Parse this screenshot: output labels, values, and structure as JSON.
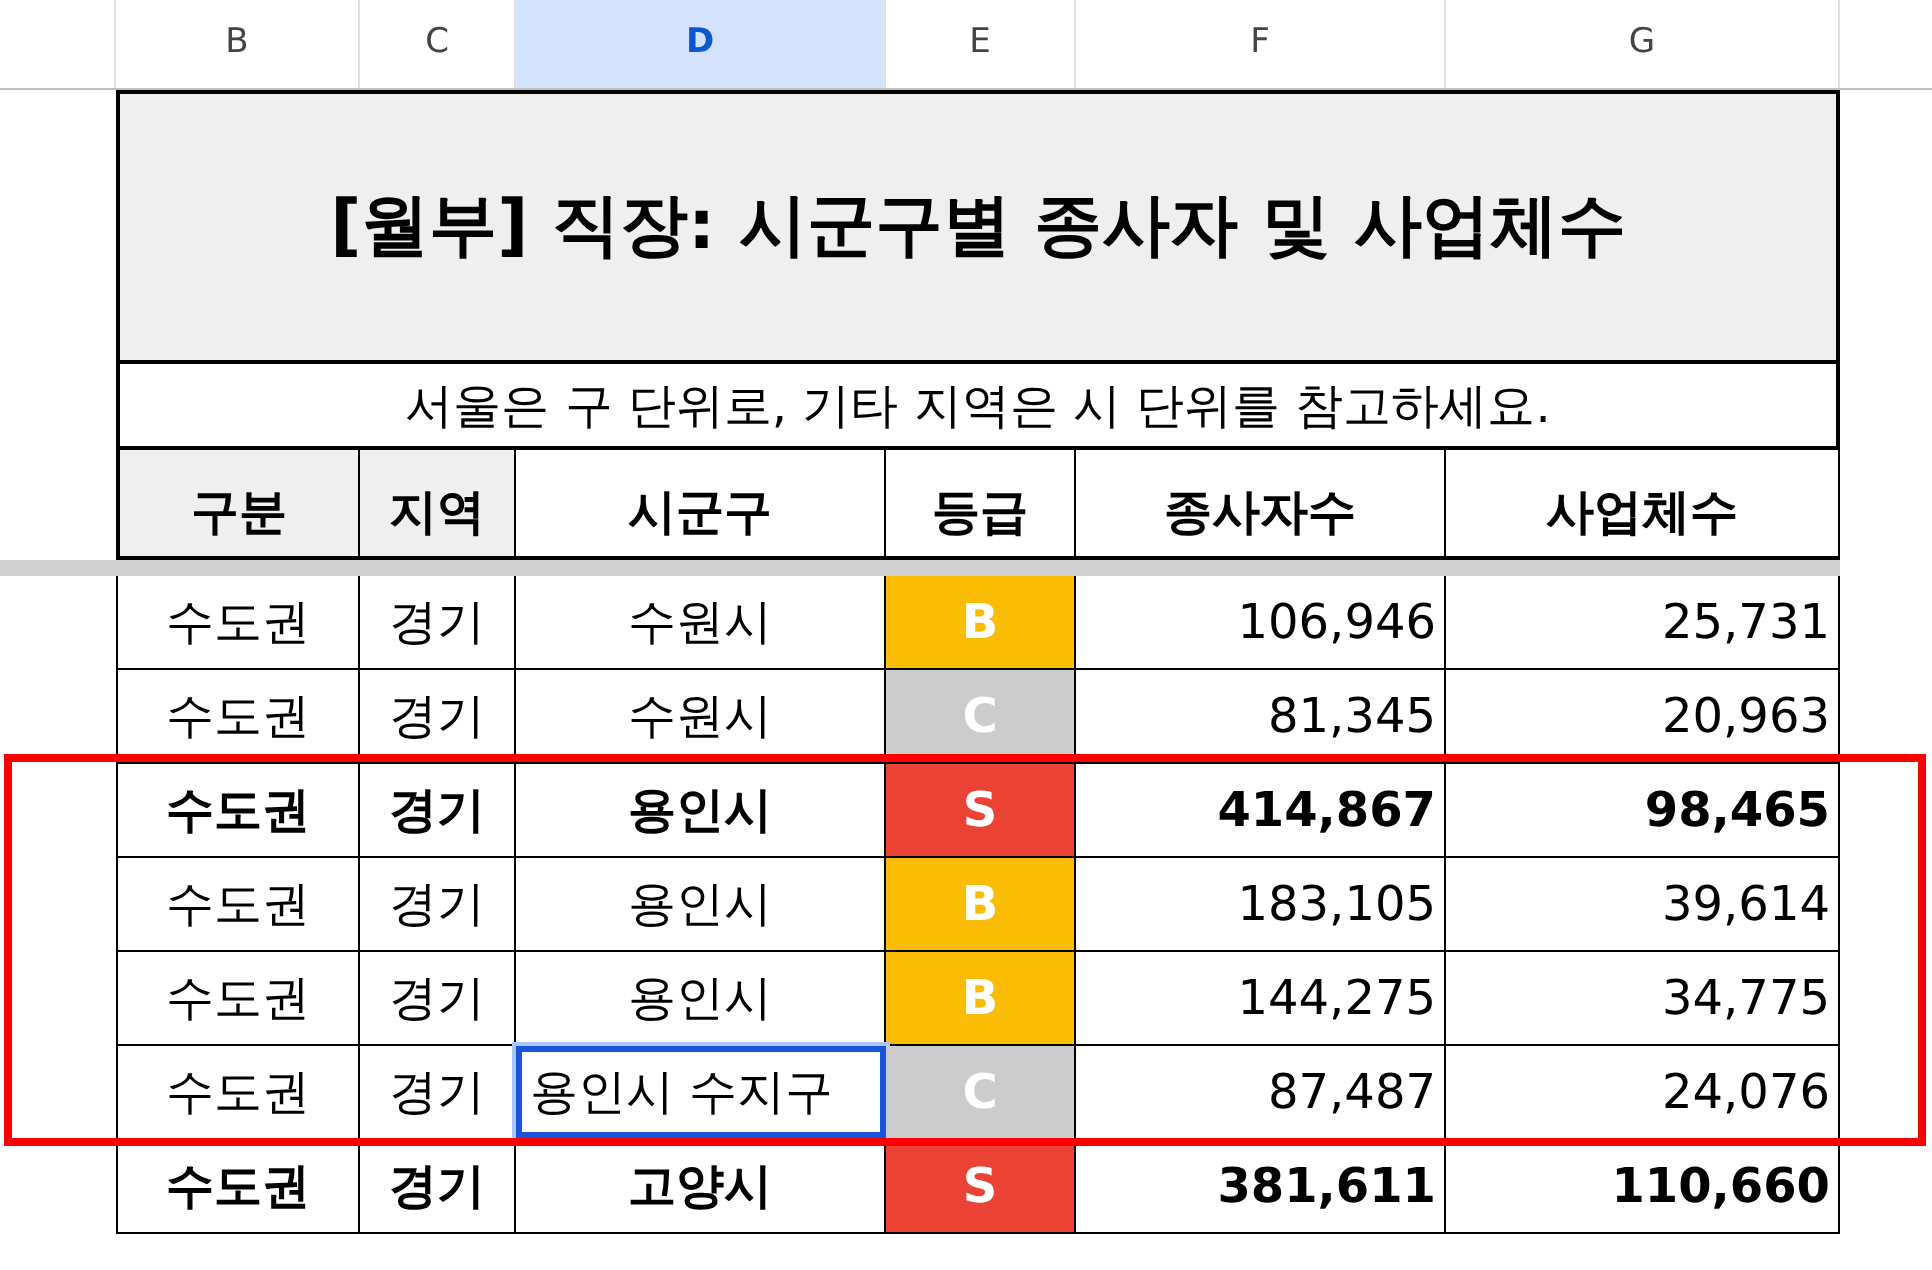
{
  "column_letters": [
    {
      "label": "B",
      "selected": false
    },
    {
      "label": "C",
      "selected": false
    },
    {
      "label": "D",
      "selected": true
    },
    {
      "label": "E",
      "selected": false
    },
    {
      "label": "F",
      "selected": false
    },
    {
      "label": "G",
      "selected": false
    }
  ],
  "title": "[월부] 직장: 시군구별 종사자 및 사업체수",
  "subtitle": "서울은 구 단위로, 기타 지역은 시 단위를 참고하세요.",
  "headers": [
    "구분",
    "지역",
    "시군구",
    "등급",
    "종사자수",
    "사업체수"
  ],
  "rows": [
    {
      "group": "수도권",
      "region": "경기",
      "district": "수원시",
      "grade": "B",
      "color": "#fbbc04",
      "workers": "106,946",
      "businesses": "25,731",
      "bold": false,
      "selected": false,
      "highlighted": false
    },
    {
      "group": "수도권",
      "region": "경기",
      "district": "수원시",
      "grade": "C",
      "color": "#cccccc",
      "workers": "81,345",
      "businesses": "20,963",
      "bold": false,
      "selected": false,
      "highlighted": false
    },
    {
      "group": "수도권",
      "region": "경기",
      "district": "용인시",
      "grade": "S",
      "color": "#ea4335",
      "workers": "414,867",
      "businesses": "98,465",
      "bold": true,
      "selected": false,
      "highlighted": true
    },
    {
      "group": "수도권",
      "region": "경기",
      "district": "용인시",
      "grade": "B",
      "color": "#fbbc04",
      "workers": "183,105",
      "businesses": "39,614",
      "bold": false,
      "selected": false,
      "highlighted": true
    },
    {
      "group": "수도권",
      "region": "경기",
      "district": "용인시",
      "grade": "B",
      "color": "#fbbc04",
      "workers": "144,275",
      "businesses": "34,775",
      "bold": false,
      "selected": false,
      "highlighted": true
    },
    {
      "group": "수도권",
      "region": "경기",
      "district": "용인시 수지구",
      "grade": "C",
      "color": "#cccccc",
      "workers": "87,487",
      "businesses": "24,076",
      "bold": false,
      "selected": true,
      "highlighted": true
    },
    {
      "group": "수도권",
      "region": "경기",
      "district": "고양시",
      "grade": "S",
      "color": "#ea4335",
      "workers": "381,611",
      "businesses": "110,660",
      "bold": true,
      "selected": false,
      "highlighted": false
    }
  ]
}
